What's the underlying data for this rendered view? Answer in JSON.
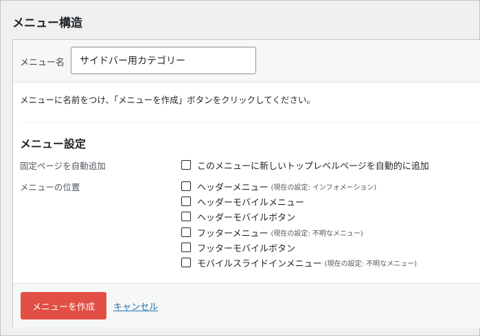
{
  "page_title": "メニュー構造",
  "menu_name": {
    "label": "メニュー名",
    "value": "サイドバー用カテゴリー"
  },
  "instruction": "メニューに名前をつけ、「メニューを作成」ボタンをクリックしてください。",
  "settings": {
    "title": "メニュー設定",
    "auto_add": {
      "label": "固定ページを自動追加",
      "option": "このメニューに新しいトップレベルページを自動的に追加",
      "checked": false
    },
    "locations": {
      "label": "メニューの位置",
      "options": [
        {
          "label": "ヘッダーメニュー",
          "note": "(現在の設定: インフォメーション)",
          "checked": false
        },
        {
          "label": "ヘッダーモバイルメニュー",
          "note": "",
          "checked": false
        },
        {
          "label": "ヘッダーモバイルボタン",
          "note": "",
          "checked": false
        },
        {
          "label": "フッターメニュー",
          "note": "(現在の設定: 不明なメニュー)",
          "checked": false
        },
        {
          "label": "フッターモバイルボタン",
          "note": "",
          "checked": false
        },
        {
          "label": "モバイルスライドインメニュー",
          "note": "(現在の設定: 不明なメニュー)",
          "checked": false
        }
      ]
    }
  },
  "actions": {
    "create_label": "メニューを作成",
    "cancel_label": "キャンセル"
  },
  "colors": {
    "create_button": "#e24f44",
    "link": "#2271b1"
  }
}
